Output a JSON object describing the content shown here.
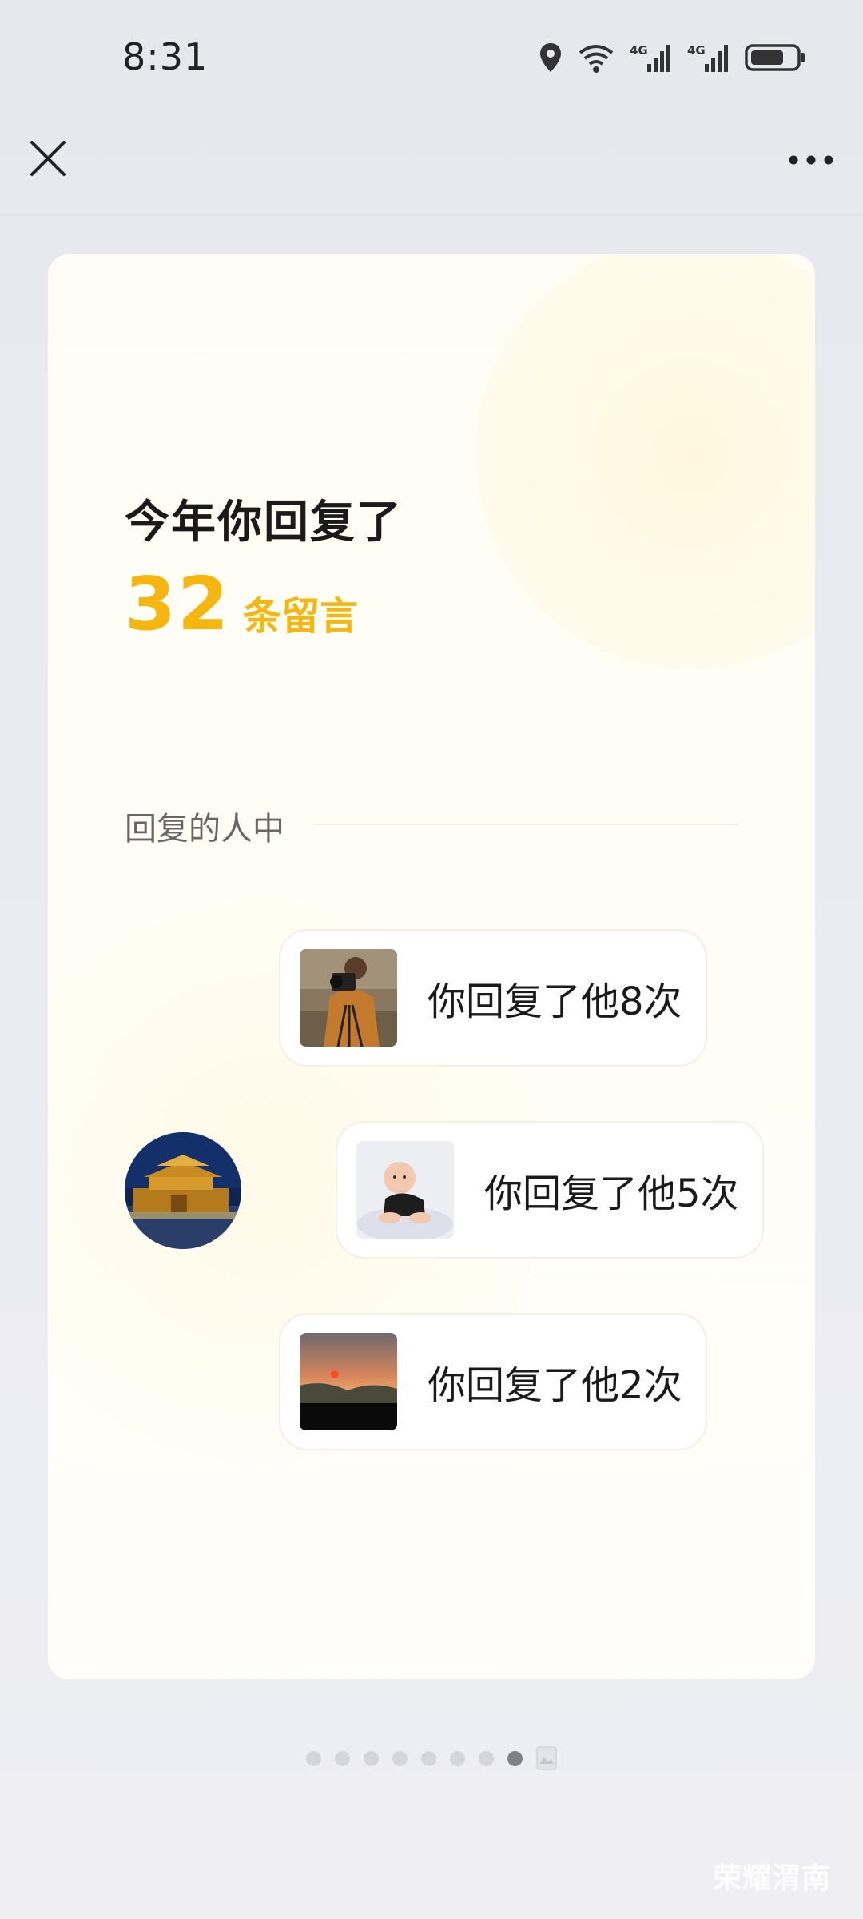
{
  "status_bar": {
    "time": "8:31",
    "net_1": "4G",
    "net_2": "4G"
  },
  "top_bar": {
    "close_icon": "close-icon",
    "more_icon": "more-icon"
  },
  "summary": {
    "headline": "今年你回复了",
    "count": "32",
    "unit": "条留言"
  },
  "section": {
    "label": "回复的人中"
  },
  "replies": [
    {
      "text": "你回复了他8次",
      "thumb": "photographer-photo"
    },
    {
      "text": "你回复了他5次",
      "thumb": "baby-photo"
    },
    {
      "text": "你回复了他2次",
      "thumb": "sunset-photo"
    }
  ],
  "avatar": {
    "icon": "city-gate-photo"
  },
  "pager": {
    "total_dots": 8,
    "active_index": 7
  },
  "watermark": "荣耀渭南",
  "colors": {
    "accent": "#f5b70f",
    "card_bg": "#fffdf6",
    "page_bg": "#e9ebf1"
  }
}
